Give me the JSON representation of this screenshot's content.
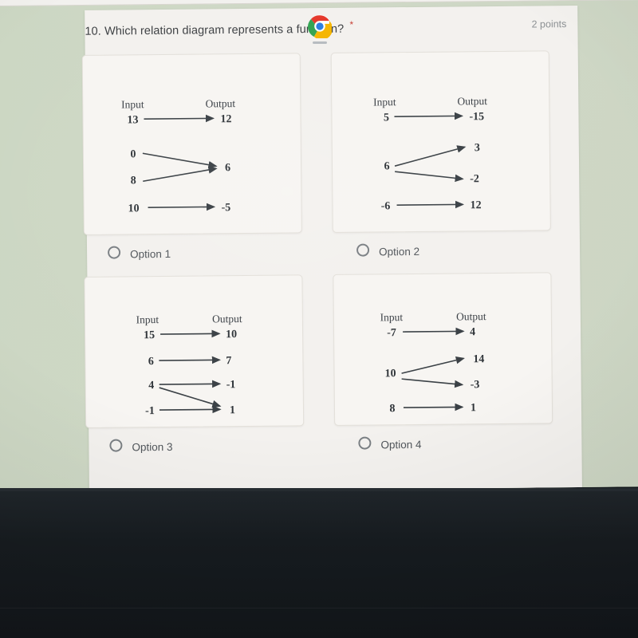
{
  "app": {
    "platform_shelf": {
      "launcher_icon": "chrome-icon",
      "launcher_label": "Chrome"
    }
  },
  "form": {
    "question_number": "10.",
    "question_text": "Which relation diagram represents a function?",
    "required_marker": "*",
    "points_label": "2 points"
  },
  "options": [
    {
      "id": "option-1",
      "label": "Option 1",
      "selected": false,
      "diagram": {
        "input_header": "Input",
        "output_header": "Output",
        "inputs": [
          "13",
          "0",
          "8",
          "10"
        ],
        "outputs": [
          "12",
          "6",
          "-5"
        ],
        "mappings": [
          {
            "from": "13",
            "to": "12"
          },
          {
            "from": "0",
            "to": "6"
          },
          {
            "from": "8",
            "to": "6"
          },
          {
            "from": "10",
            "to": "-5"
          }
        ]
      }
    },
    {
      "id": "option-2",
      "label": "Option 2",
      "selected": false,
      "diagram": {
        "input_header": "Input",
        "output_header": "Output",
        "inputs": [
          "5",
          "6",
          "-6"
        ],
        "outputs": [
          "-15",
          "3",
          "-2",
          "12"
        ],
        "mappings": [
          {
            "from": "5",
            "to": "-15"
          },
          {
            "from": "6",
            "to": "3"
          },
          {
            "from": "6",
            "to": "-2"
          },
          {
            "from": "-6",
            "to": "12"
          }
        ]
      }
    },
    {
      "id": "option-3",
      "label": "Option 3",
      "selected": false,
      "diagram": {
        "input_header": "Input",
        "output_header": "Output",
        "inputs": [
          "15",
          "6",
          "4",
          "-1"
        ],
        "outputs": [
          "10",
          "7",
          "-1",
          "1"
        ],
        "mappings": [
          {
            "from": "15",
            "to": "10"
          },
          {
            "from": "6",
            "to": "7"
          },
          {
            "from": "4",
            "to": "-1"
          },
          {
            "from": "4",
            "to": "1"
          },
          {
            "from": "-1",
            "to": "1"
          }
        ]
      }
    },
    {
      "id": "option-4",
      "label": "Option 4",
      "selected": false,
      "diagram": {
        "input_header": "Input",
        "output_header": "Output",
        "inputs": [
          "-7",
          "10",
          "8"
        ],
        "outputs": [
          "4",
          "14",
          "-3",
          "1"
        ],
        "mappings": [
          {
            "from": "-7",
            "to": "4"
          },
          {
            "from": "10",
            "to": "14"
          },
          {
            "from": "10",
            "to": "-3"
          },
          {
            "from": "8",
            "to": "1"
          }
        ]
      }
    }
  ],
  "colors": {
    "page_background": "#ccd7c3",
    "card_background": "#f3f1ee",
    "image_card_background": "#f7f5f2",
    "text_primary": "#3d4043",
    "text_secondary": "#8d9194",
    "required_red": "#c5372c",
    "shelf_dark": "#171c20"
  }
}
